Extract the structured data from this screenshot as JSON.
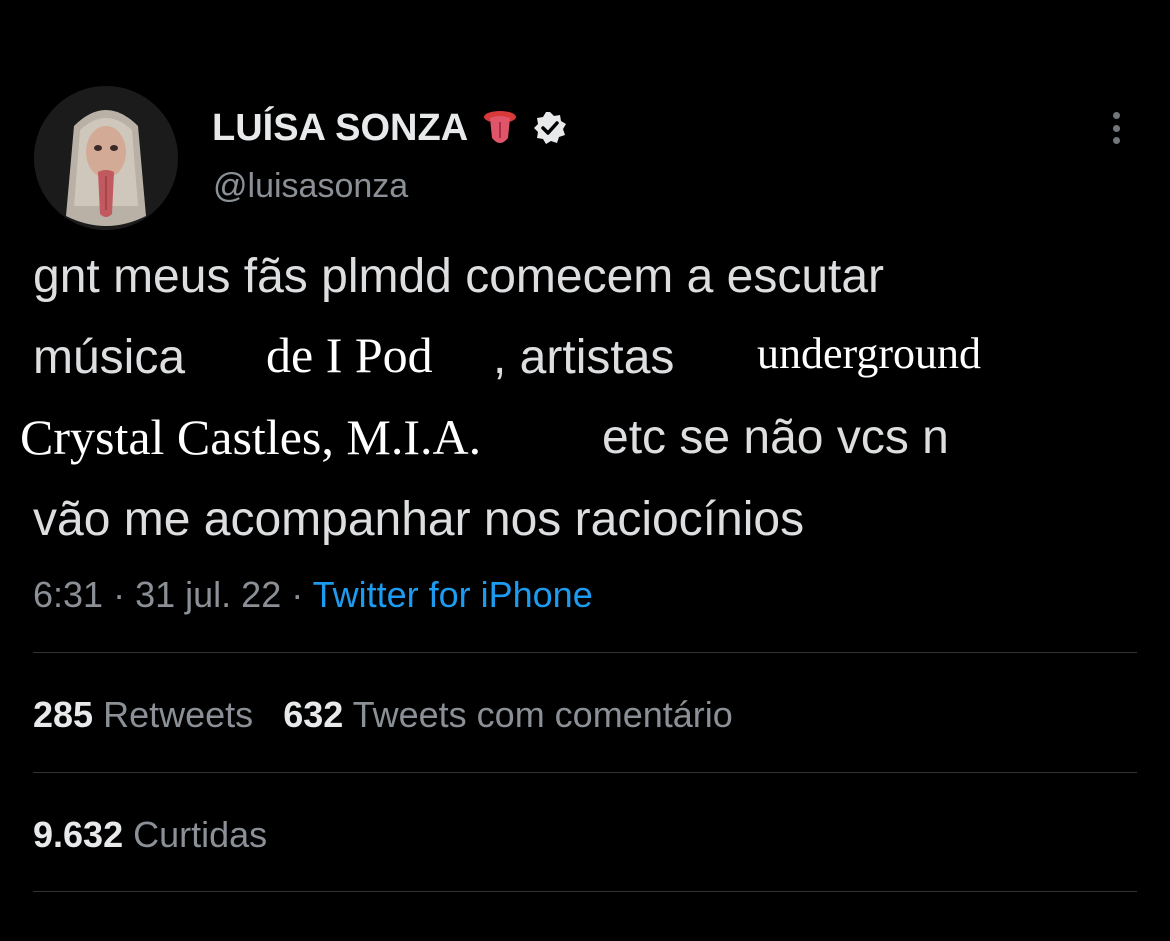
{
  "user": {
    "display_name": "LUÍSA SONZA",
    "handle": "@luisasonza",
    "emoji_icon": "tongue-icon",
    "verified_icon": "verified-badge-icon"
  },
  "tweet": {
    "line1": "gnt meus fãs plmdd comecem a escutar",
    "line2_a": "música",
    "line2_b": "de I Pod",
    "line2_c": ", artistas",
    "line2_d": "underground",
    "line3_a": "Crystal Castles, M.I.A.",
    "line3_b": "etc se não vcs n",
    "line4": "vão me acompanhar nos raciocínios"
  },
  "meta": {
    "time": "6:31",
    "date": "31 jul. 22",
    "separator": "·",
    "source": "Twitter for iPhone"
  },
  "stats": {
    "retweets_count": "285",
    "retweets_label": "Retweets",
    "quotes_count": "632",
    "quotes_label": "Tweets com comentário",
    "likes_count": "9.632",
    "likes_label": "Curtidas"
  },
  "colors": {
    "background": "#000000",
    "link": "#1d9bf0",
    "secondary_text": "#8b9096",
    "divider": "#2f3336"
  }
}
